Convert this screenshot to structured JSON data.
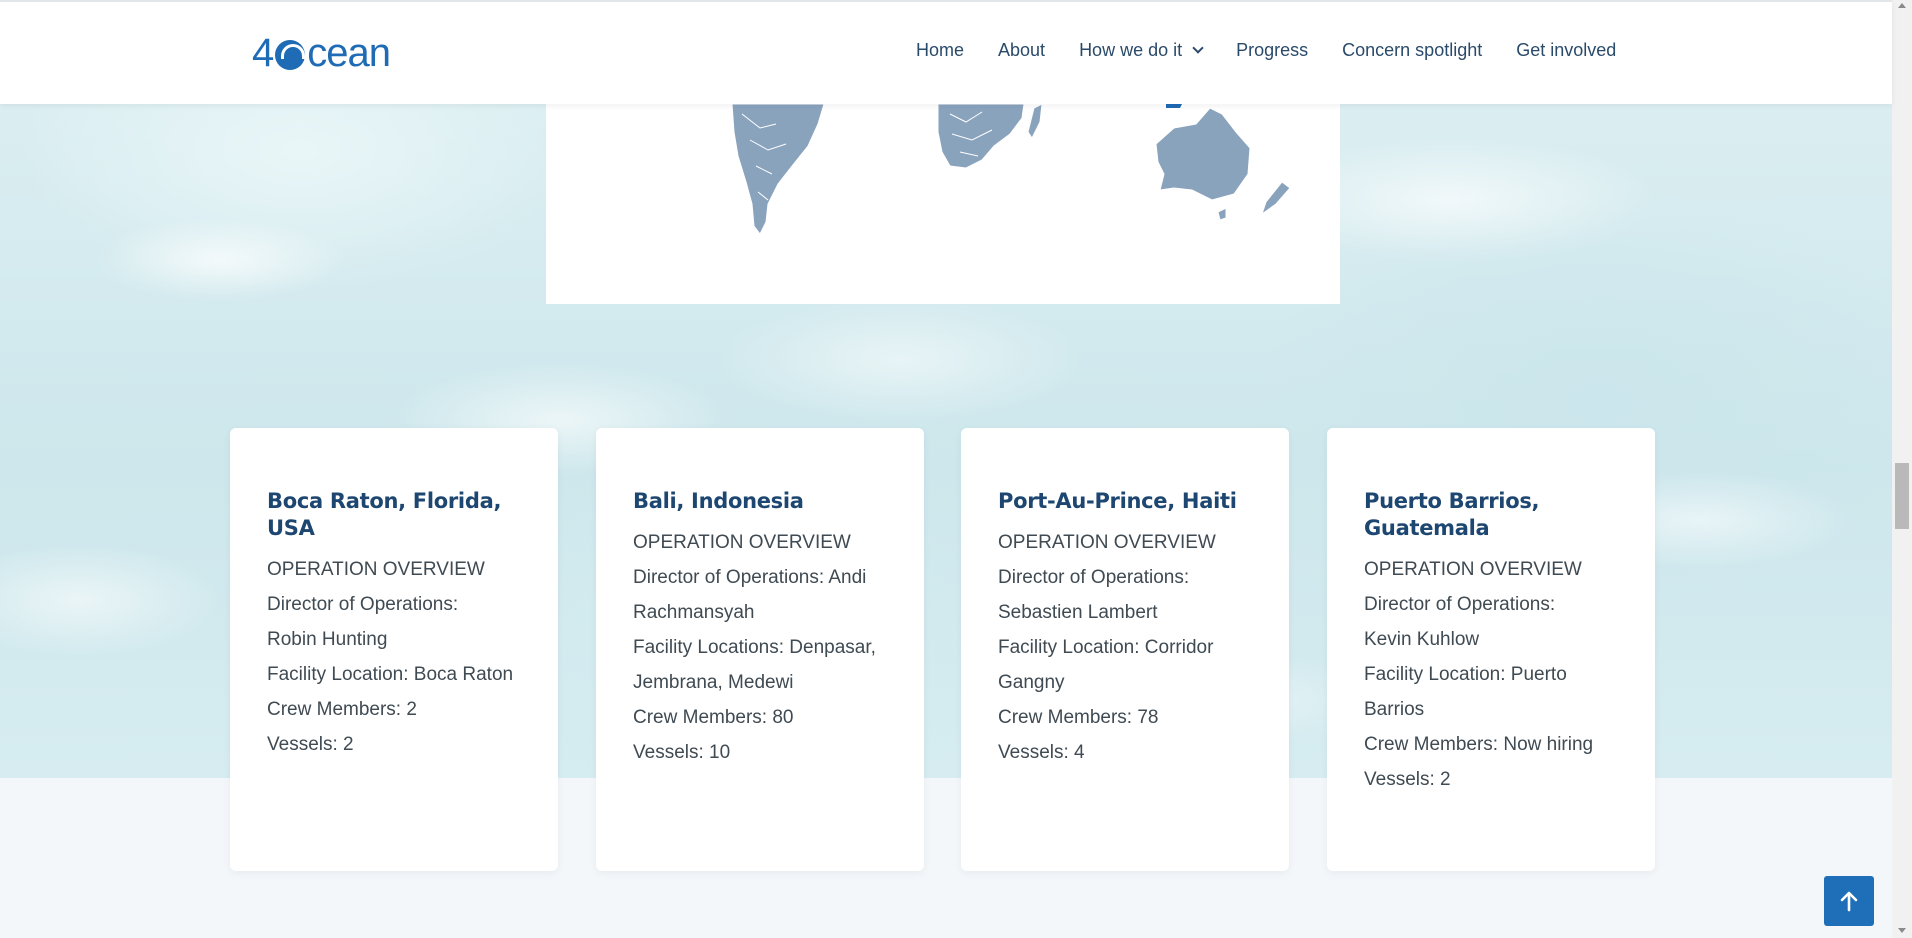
{
  "brand": {
    "logo_text_a": "4",
    "logo_text_b": "cean",
    "accent": "#1f6bb5"
  },
  "nav": {
    "items": [
      {
        "label": "Home"
      },
      {
        "label": "About"
      },
      {
        "label": "How we do it",
        "has_dropdown": true
      },
      {
        "label": "Progress"
      },
      {
        "label": "Concern spotlight"
      },
      {
        "label": "Get involved"
      }
    ]
  },
  "cards": [
    {
      "title": "Boca Raton, Florida, USA",
      "lines": [
        "OPERATION OVERVIEW",
        "Director of Operations:",
        "Robin Hunting",
        "Facility Location: Boca Raton",
        "Crew Members: 2",
        "Vessels: 2"
      ]
    },
    {
      "title": "Bali, Indonesia",
      "lines": [
        "OPERATION OVERVIEW",
        "Director of Operations: Andi",
        "Rachmansyah",
        "Facility Locations: Denpasar,",
        "Jembrana, Medewi",
        "Crew Members: 80",
        "Vessels: 10"
      ]
    },
    {
      "title": "Port-Au-Prince, Haiti",
      "lines": [
        "OPERATION OVERVIEW",
        "Director of Operations:",
        "Sebastien Lambert",
        "Facility Location: Corridor",
        "Gangny",
        "Crew Members: 78",
        "Vessels: 4"
      ]
    },
    {
      "title": "Puerto Barrios, Guatemala",
      "lines": [
        "OPERATION OVERVIEW",
        "Director of Operations:",
        "Kevin Kuhlow",
        "Facility Location: Puerto",
        "Barrios",
        "Crew Members: Now hiring",
        "Vessels: 2"
      ]
    }
  ],
  "colors": {
    "map_land": "#8aa3bd",
    "card_title": "#1d4670",
    "back_to_top": "#1f6fb8"
  },
  "icons": {
    "back_to_top": "arrow-up-icon",
    "dropdown": "chevron-down-icon"
  }
}
